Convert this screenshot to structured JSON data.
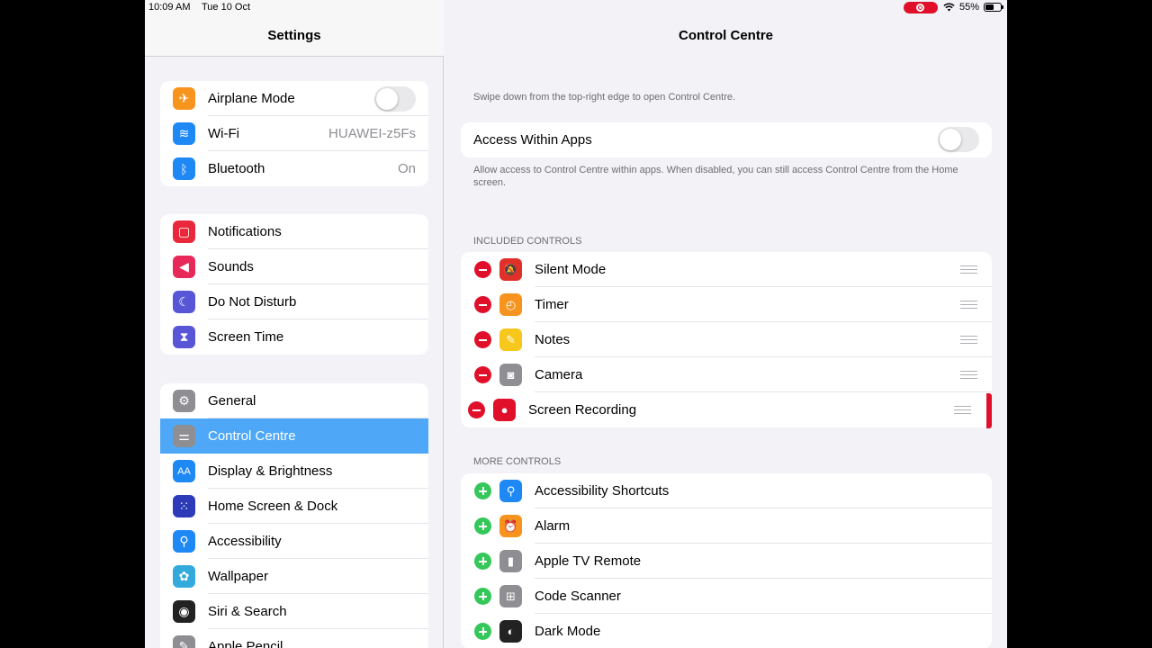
{
  "status_bar": {
    "time": "10:09 AM",
    "date": "Tue 10 Oct",
    "battery": "55%"
  },
  "sidebar": {
    "title": "Settings",
    "groups": [
      [
        {
          "label": "Airplane Mode",
          "icon": "airplane-icon",
          "color": "#f7941d",
          "toggle": false
        },
        {
          "label": "Wi-Fi",
          "icon": "wifi-icon",
          "color": "#1e88f5",
          "value": "HUAWEI-z5Fs"
        },
        {
          "label": "Bluetooth",
          "icon": "bluetooth-icon",
          "color": "#1e88f5",
          "value": "On"
        }
      ],
      [
        {
          "label": "Notifications",
          "icon": "notifications-icon",
          "color": "#e9283c"
        },
        {
          "label": "Sounds",
          "icon": "speaker-icon",
          "color": "#e9285a"
        },
        {
          "label": "Do Not Disturb",
          "icon": "moon-icon",
          "color": "#5856d6"
        },
        {
          "label": "Screen Time",
          "icon": "hourglass-icon",
          "color": "#5856d6"
        }
      ],
      [
        {
          "label": "General",
          "icon": "gear-icon",
          "color": "#8e8e93"
        },
        {
          "label": "Control Centre",
          "icon": "switches-icon",
          "color": "#8e8e93",
          "selected": true
        },
        {
          "label": "Display & Brightness",
          "icon": "text-size-icon",
          "color": "#1e88f5"
        },
        {
          "label": "Home Screen & Dock",
          "icon": "home-grid-icon",
          "color": "#2d3bb8"
        },
        {
          "label": "Accessibility",
          "icon": "accessibility-icon",
          "color": "#1e88f5"
        },
        {
          "label": "Wallpaper",
          "icon": "flower-icon",
          "color": "#34aadc"
        },
        {
          "label": "Siri & Search",
          "icon": "siri-icon",
          "color": "#222222"
        },
        {
          "label": "Apple Pencil",
          "icon": "pencil-icon",
          "color": "#8e8e93"
        }
      ]
    ]
  },
  "main": {
    "title": "Control Centre",
    "intro": "Swipe down from the top-right edge to open Control Centre.",
    "access_label": "Access Within Apps",
    "access_toggle": false,
    "access_note": "Allow access to Control Centre within apps. When disabled, you can still access Control Centre from the Home screen.",
    "included_header": "INCLUDED CONTROLS",
    "included": [
      {
        "label": "Silent Mode",
        "icon": "bell-slash-icon",
        "color": "#e0302a"
      },
      {
        "label": "Timer",
        "icon": "timer-icon",
        "color": "#f7941d"
      },
      {
        "label": "Notes",
        "icon": "notes-icon",
        "color": "#f7c71d"
      },
      {
        "label": "Camera",
        "icon": "camera-icon",
        "color": "#8e8e93"
      },
      {
        "label": "Screen Recording",
        "icon": "record-icon",
        "color": "#e0102a",
        "dragging": true
      }
    ],
    "more_header": "MORE CONTROLS",
    "more": [
      {
        "label": "Accessibility Shortcuts",
        "icon": "accessibility-icon",
        "color": "#1e88f5"
      },
      {
        "label": "Alarm",
        "icon": "alarm-icon",
        "color": "#f7941d"
      },
      {
        "label": "Apple TV Remote",
        "icon": "remote-icon",
        "color": "#8e8e93"
      },
      {
        "label": "Code Scanner",
        "icon": "qr-scanner-icon",
        "color": "#8e8e93"
      },
      {
        "label": "Dark Mode",
        "icon": "dark-mode-icon",
        "color": "#222222"
      }
    ]
  }
}
